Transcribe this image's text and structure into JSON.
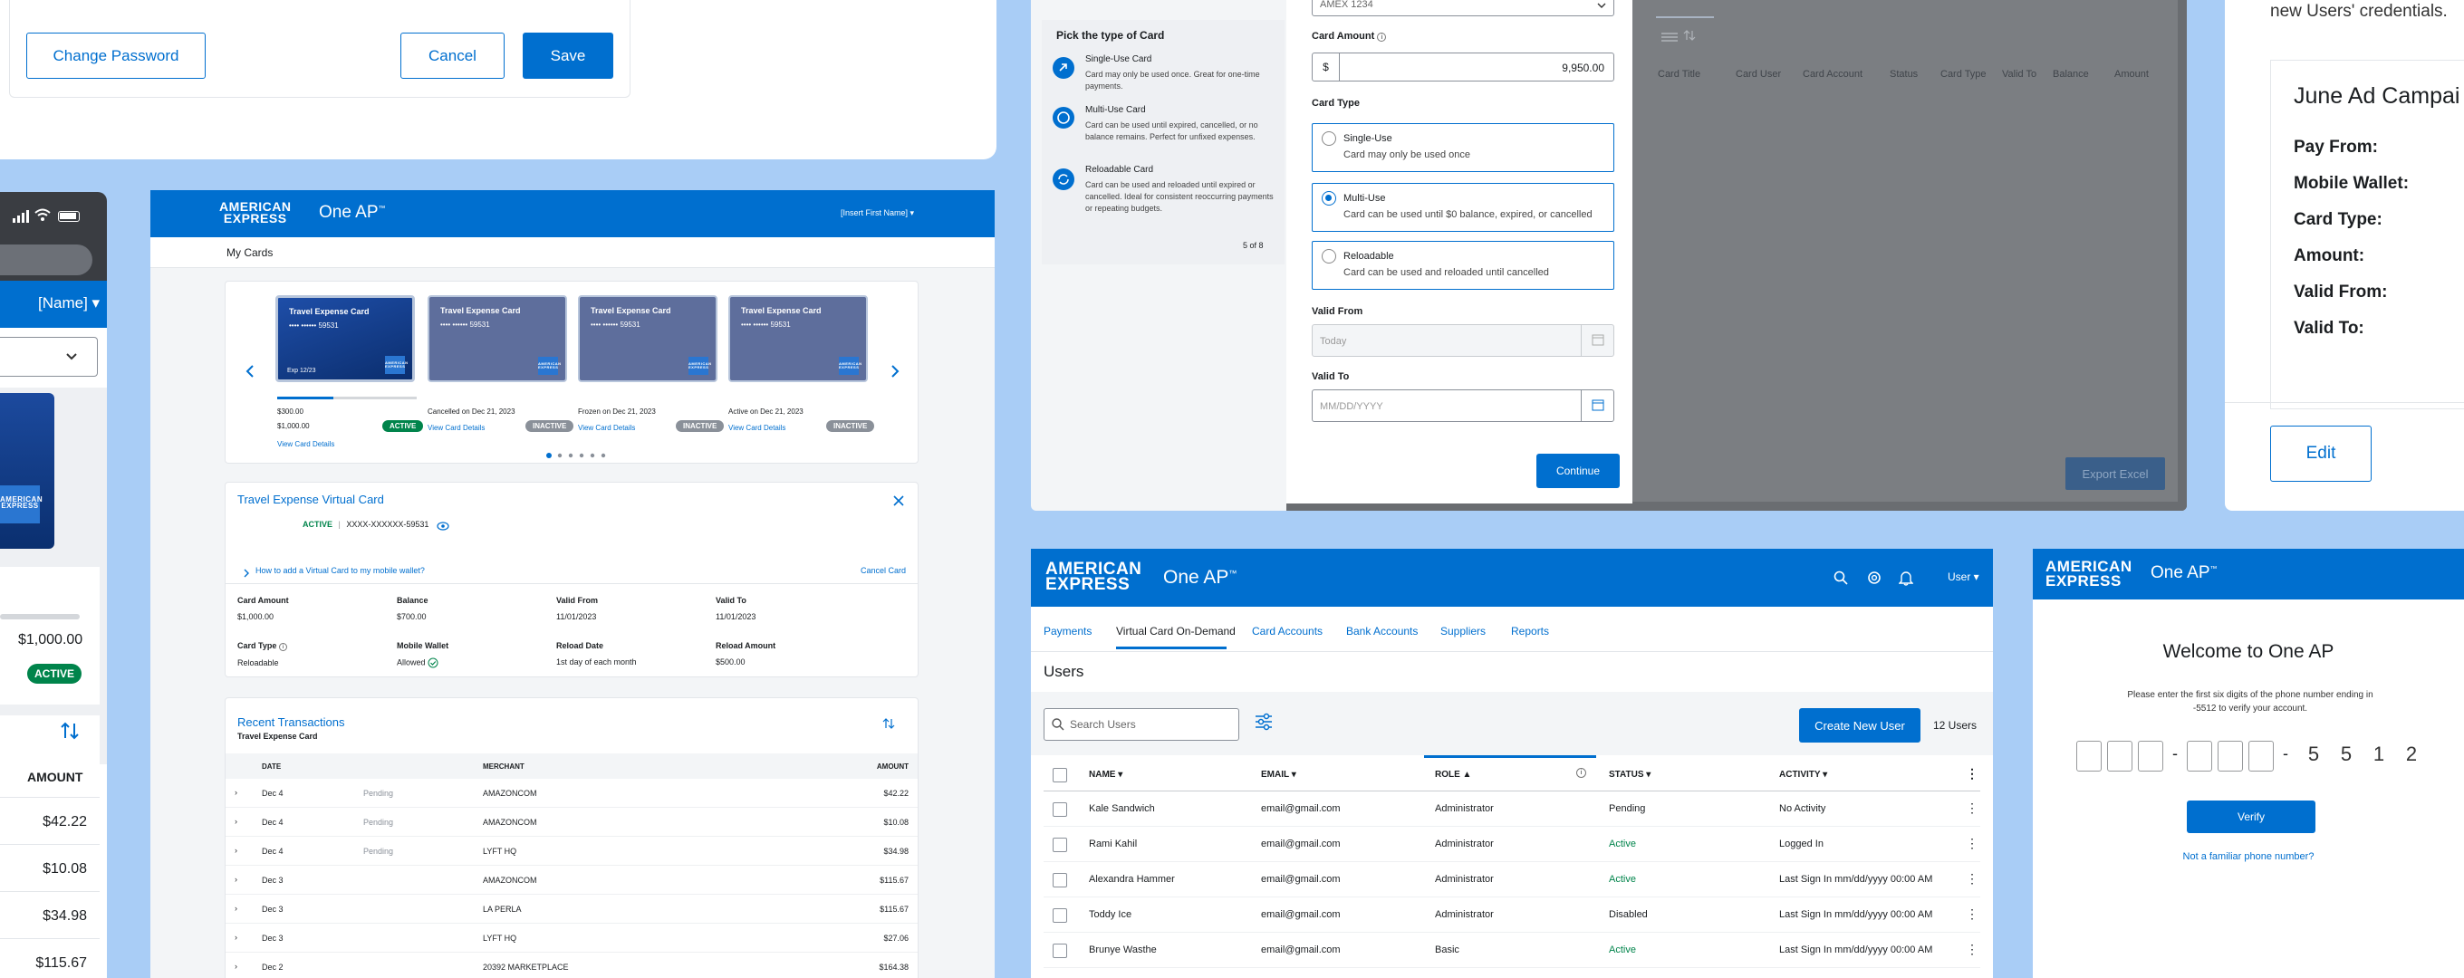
{
  "p1": {
    "change_password": "Change Password",
    "cancel": "Cancel",
    "save": "Save"
  },
  "phone": {
    "name": "[Name] ▾",
    "amount": "$1,000.00",
    "active": "ACTIVE",
    "col_amount": "AMOUNT",
    "amounts": [
      "$42.22",
      "$10.08",
      "$34.98",
      "$115.67"
    ]
  },
  "cards": {
    "header_brand": "One AP",
    "user": "[Insert First Name] ▾",
    "my_cards": "My Cards",
    "list": [
      {
        "name": "Travel Expense Card",
        "num": "•••• •••••• 59531",
        "exp": "Exp 12/23",
        "left": "$300.00",
        "sub": "$1,000.00",
        "status": "ACTIVE",
        "link": "View Card Details"
      },
      {
        "name": "Travel Expense Card",
        "num": "•••• •••••• 59531",
        "left": "Cancelled on Dec 21, 2023",
        "status": "INACTIVE",
        "link": "View Card Details"
      },
      {
        "name": "Travel Expense Card",
        "num": "•••• •••••• 59531",
        "left": "Frozen on Dec 21, 2023",
        "status": "INACTIVE",
        "link": "View Card Details"
      },
      {
        "name": "Travel Expense Card",
        "num": "•••• •••••• 59531",
        "left": "Active on Dec 21, 2023",
        "status": "INACTIVE",
        "link": "View Card Details"
      }
    ],
    "detail": {
      "title": "Travel Expense Virtual Card",
      "active": "ACTIVE",
      "num": "XXXX-XXXXXX-59531",
      "wallet_link": "How to add a Virtual Card to my mobile wallet?",
      "cancel": "Cancel Card",
      "f": [
        {
          "l": "Card Amount",
          "v": "$1,000.00"
        },
        {
          "l": "Balance",
          "v": "$700.00"
        },
        {
          "l": "Valid From",
          "v": "11/01/2023"
        },
        {
          "l": "Valid To",
          "v": "11/01/2023"
        },
        {
          "l": "Card Type",
          "v": "Reloadable"
        },
        {
          "l": "Mobile Wallet",
          "v": "Allowed"
        },
        {
          "l": "Reload Date",
          "v": "1st day of each month"
        },
        {
          "l": "Reload Amount",
          "v": "$500.00"
        }
      ]
    },
    "tx": {
      "title": "Recent Transactions",
      "sub": "Travel Expense Card",
      "cols": [
        "DATE",
        "MERCHANT",
        "AMOUNT"
      ],
      "rows": [
        {
          "d": "Dec 4",
          "s": "Pending",
          "m": "AMAZONCOM",
          "a": "$42.22"
        },
        {
          "d": "Dec 4",
          "s": "Pending",
          "m": "AMAZONCOM",
          "a": "$10.08"
        },
        {
          "d": "Dec 4",
          "s": "Pending",
          "m": "LYFT HQ",
          "a": "$34.98"
        },
        {
          "d": "Dec 3",
          "s": "",
          "m": "AMAZONCOM",
          "a": "$115.67"
        },
        {
          "d": "Dec 3",
          "s": "",
          "m": "LA PERLA",
          "a": "$115.67"
        },
        {
          "d": "Dec 3",
          "s": "",
          "m": "LYFT HQ",
          "a": "$27.06"
        },
        {
          "d": "Dec 2",
          "s": "",
          "m": "20392 MARKETPLACE",
          "a": "$164.38"
        }
      ]
    }
  },
  "ctype": {
    "title": "Pick the type of Card",
    "items": [
      {
        "t": "Single-Use Card",
        "d": "Card may only be used once. Great for one-time payments."
      },
      {
        "t": "Multi-Use Card",
        "d": "Card can be used until expired, cancelled, or no balance remains. Perfect for unfixed expenses."
      },
      {
        "t": "Reloadable Card",
        "d": "Card can be used and reloaded until expired or cancelled. Ideal for consistent reoccurring payments or repeating budgets."
      }
    ],
    "step": "5 of 8"
  },
  "form": {
    "top_select": "AMEX 1234",
    "amount_label": "Card Amount",
    "dollar": "$",
    "amount": "9,950.00",
    "type_label": "Card Type",
    "opts": [
      {
        "t": "Single-Use",
        "d": "Card may only be used once"
      },
      {
        "t": "Multi-Use",
        "d": "Card can be used until $0 balance, expired, or cancelled"
      },
      {
        "t": "Reloadable",
        "d": "Card can be used and reloaded until cancelled"
      }
    ],
    "from_label": "Valid From",
    "from": "Today",
    "to_label": "Valid To",
    "to_ph": "MM/DD/YYYY",
    "continue": "Continue"
  },
  "bg": {
    "cols": [
      "Card Title",
      "Card User",
      "Card Account",
      "Status",
      "Card Type",
      "Valid To",
      "Balance",
      "Amount"
    ],
    "export": "Export Excel"
  },
  "summary": {
    "top": "new Users' credentials.",
    "title": "June Ad Campai",
    "labels": [
      "Pay From:",
      "Mobile Wallet:",
      "Card Type:",
      "Amount:",
      "Valid From:",
      "Valid To:"
    ],
    "edit": "Edit"
  },
  "users": {
    "brand": "One AP",
    "user": "User ▾",
    "nav": [
      "Payments",
      "Virtual Card On-Demand",
      "Card Accounts",
      "Bank Accounts",
      "Suppliers",
      "Reports"
    ],
    "heading": "Users",
    "search_ph": "Search Users",
    "create": "Create New User",
    "count": "12 Users",
    "cols": [
      "NAME",
      "EMAIL",
      "ROLE",
      "STATUS",
      "ACTIVITY"
    ],
    "rows": [
      {
        "n": "Kale Sandwich",
        "e": "email@gmail.com",
        "r": "Administrator",
        "s": "Pending",
        "a": "No Activity"
      },
      {
        "n": "Rami Kahil",
        "e": "email@gmail.com",
        "r": "Administrator",
        "s": "Active",
        "a": "Logged In"
      },
      {
        "n": "Alexandra Hammer",
        "e": "email@gmail.com",
        "r": "Administrator",
        "s": "Active",
        "a": "Last Sign In mm/dd/yyyy 00:00 AM"
      },
      {
        "n": "Toddy Ice",
        "e": "email@gmail.com",
        "r": "Administrator",
        "s": "Disabled",
        "a": "Last Sign In mm/dd/yyyy 00:00 AM"
      },
      {
        "n": "Brunye Wasthe",
        "e": "email@gmail.com",
        "r": "Basic",
        "s": "Active",
        "a": "Last Sign In mm/dd/yyyy 00:00 AM"
      }
    ]
  },
  "welcome": {
    "brand": "One AP",
    "title": "Welcome to One AP",
    "desc": "Please enter the first six digits of the phone number ending in -5512 to verify your account.",
    "digits": [
      "5",
      "5",
      "1",
      "2"
    ],
    "verify": "Verify",
    "link": "Not a familiar phone number?"
  },
  "amex": {
    "l1": "AMERICAN",
    "l2": "EXPRESS"
  },
  "colors": {
    "brand": "#006fcf",
    "green": "#00844b",
    "bg": "#a9cdf6"
  }
}
